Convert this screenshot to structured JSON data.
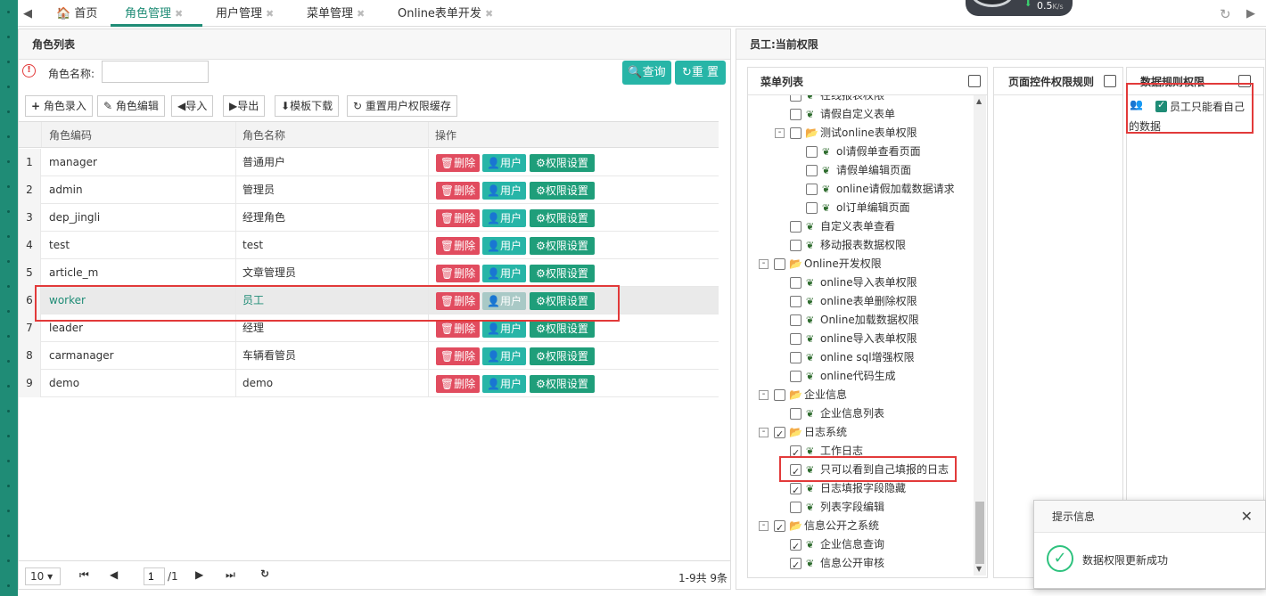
{
  "tabs": [
    {
      "label": "首页"
    },
    {
      "label": "角色管理"
    },
    {
      "label": "用户管理"
    },
    {
      "label": "菜单管理"
    },
    {
      "label": "Online表单开发"
    }
  ],
  "net_speed": "0.5",
  "net_unit": "K/s",
  "left_panel": {
    "title": "角色列表",
    "search_label": "角色名称:",
    "search_value": "",
    "query_btn": "查询",
    "reset_btn": "重 置",
    "toolbar": [
      "角色录入",
      "角色编辑",
      "导入",
      "导出",
      "模板下载",
      "重置用户权限缓存"
    ],
    "columns": [
      "角色编码",
      "角色名称",
      "操作"
    ],
    "action_labels": {
      "delete": "删除",
      "user": "用户",
      "perm": "权限设置"
    },
    "rows": [
      {
        "n": "1",
        "code": "manager",
        "name": "普通用户"
      },
      {
        "n": "2",
        "code": "admin",
        "name": "管理员"
      },
      {
        "n": "3",
        "code": "dep_jingli",
        "name": "经理角色"
      },
      {
        "n": "4",
        "code": "test",
        "name": "test"
      },
      {
        "n": "5",
        "code": "article_m",
        "name": "文章管理员"
      },
      {
        "n": "6",
        "code": "worker",
        "name": "员工"
      },
      {
        "n": "7",
        "code": "leader",
        "name": "经理"
      },
      {
        "n": "8",
        "code": "carmanager",
        "name": "车辆看管员"
      },
      {
        "n": "9",
        "code": "demo",
        "name": "demo"
      }
    ],
    "pager": {
      "page_size": "10",
      "page": "1",
      "total_pages": "/1",
      "summary": "1-9共 9条"
    }
  },
  "right_panel": {
    "title": "员工:当前权限",
    "menu_col": "菜单列表",
    "page_col": "页面控件权限规则",
    "data_col": "数据规则权限",
    "data_rule_label": "员工只能看自己的数据",
    "tree": [
      "在线报表权限",
      "请假自定义表单",
      "测试online表单权限",
      "ol请假单查看页面",
      "请假单编辑页面",
      "online请假加载数据请求",
      "ol订单编辑页面",
      "自定义表单查看",
      "移动报表数据权限",
      "Online开发权限",
      "online导入表单权限",
      "online表单删除权限",
      "Online加载数据权限",
      "online导入表单权限",
      "online sql增强权限",
      "online代码生成",
      "企业信息",
      "企业信息列表",
      "日志系统",
      "工作日志",
      "只可以看到自己填报的日志",
      "日志填报字段隐藏",
      "列表字段编辑",
      "信息公开之系统",
      "企业信息查询",
      "信息公开审核"
    ]
  },
  "toast": {
    "title": "提示信息",
    "message": "数据权限更新成功"
  }
}
